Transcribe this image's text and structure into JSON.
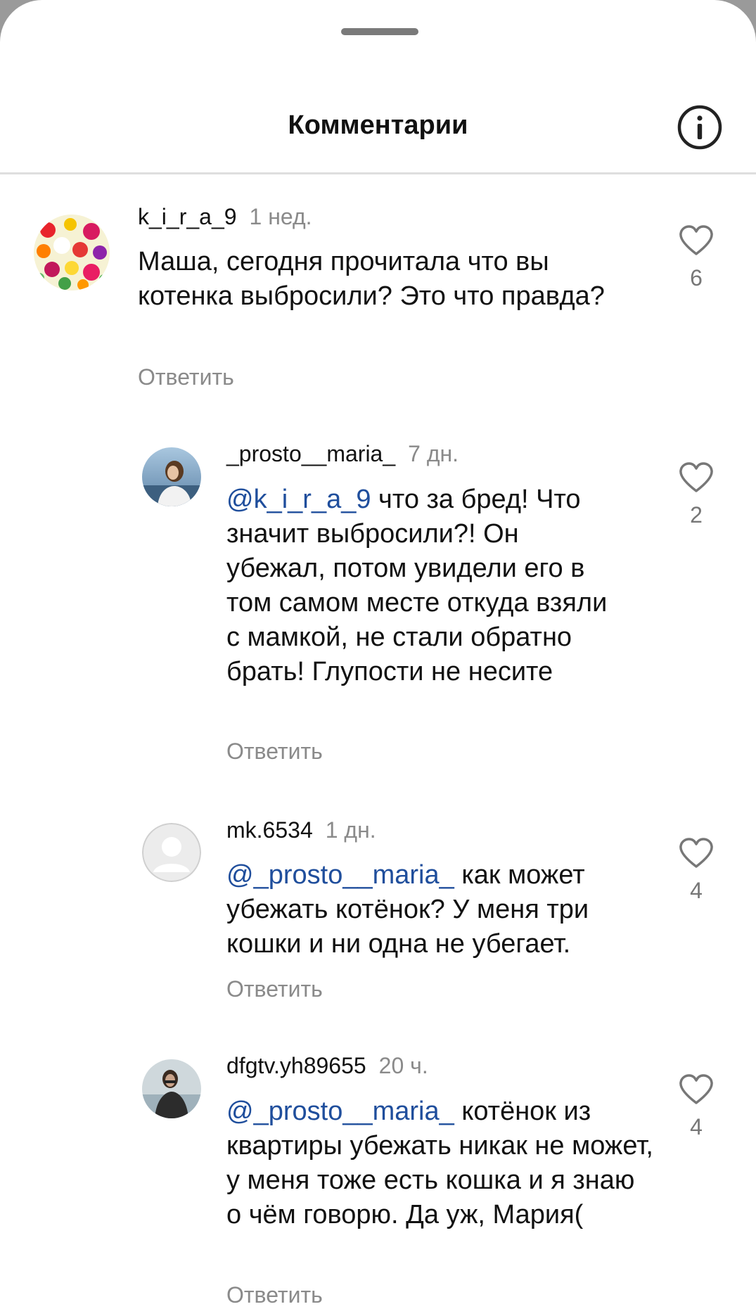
{
  "header": {
    "title": "Комментарии",
    "info_icon": "info-icon"
  },
  "comments": [
    {
      "username": "k_i_r_a_9",
      "time": "1 нед.",
      "mention": "",
      "text": "Маша, сегодня прочитала что вы котенка выбросили? Это что правда?",
      "reply_label": "Ответить",
      "likes": "6",
      "avatar": "flowers"
    },
    {
      "username": "_prosto__maria_",
      "time": "7 дн.",
      "mention": "@k_i_r_a_9",
      "text": "что за бред! Что значит выбросили?! Он убежал, потом увидели его в том самом месте откуда взяли с мамкой, не стали обратно брать! Глупости не несите",
      "reply_label": "Ответить",
      "likes": "2",
      "avatar": "photo"
    },
    {
      "username": "mk.6534",
      "time": "1 дн.",
      "mention": "@_prosto__maria_",
      "text": "как может убежать котёнок? У меня три кошки и ни одна не убегает.",
      "reply_label": "Ответить",
      "likes": "4",
      "avatar": "default"
    },
    {
      "username": "dfgtv.yh89655",
      "time": "20 ч.",
      "mention": "@_prosto__maria_",
      "text": "котёнок из квартиры убежать никак не может, у меня тоже есть кошка и я знаю о чём говорю. Да уж, Мария(",
      "reply_label": "Ответить",
      "likes": "4",
      "avatar": "photo"
    }
  ],
  "colors": {
    "mention": "#1f4e9c",
    "secondary_text": "#8a8a8a",
    "divider": "#dedede"
  }
}
